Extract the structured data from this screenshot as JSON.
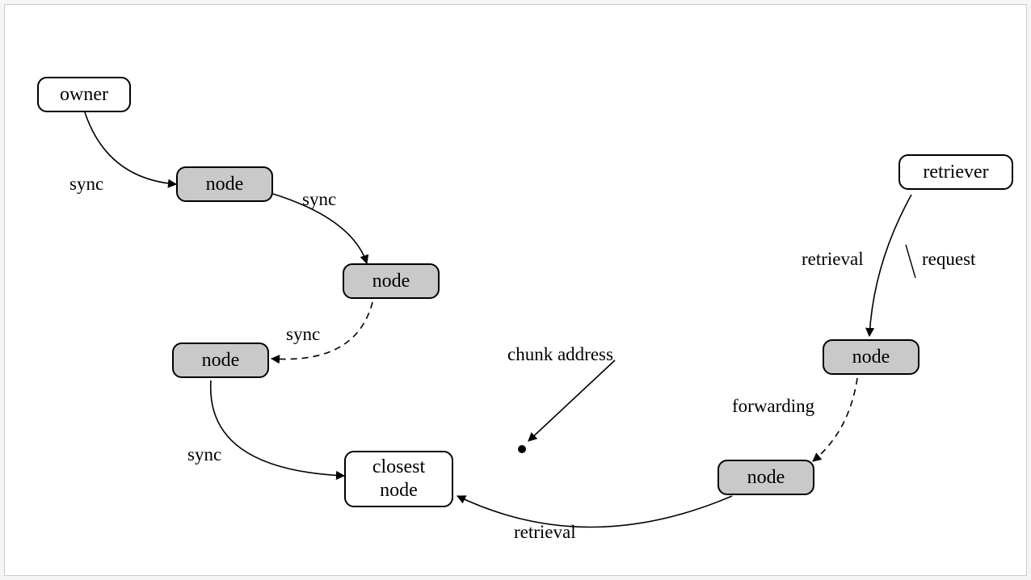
{
  "nodes": {
    "owner": "owner",
    "retriever": "retriever",
    "node1": "node",
    "node2": "node",
    "node3": "node",
    "node4": "node",
    "node5": "node",
    "closest": "closest\nnode"
  },
  "labels": {
    "sync1": "sync",
    "sync2": "sync",
    "sync3": "sync",
    "sync4": "sync",
    "chunk": "chunk address",
    "retrieval1": "retrieval",
    "request": "request",
    "forwarding": "forwarding",
    "retrieval2": "retrieval"
  }
}
